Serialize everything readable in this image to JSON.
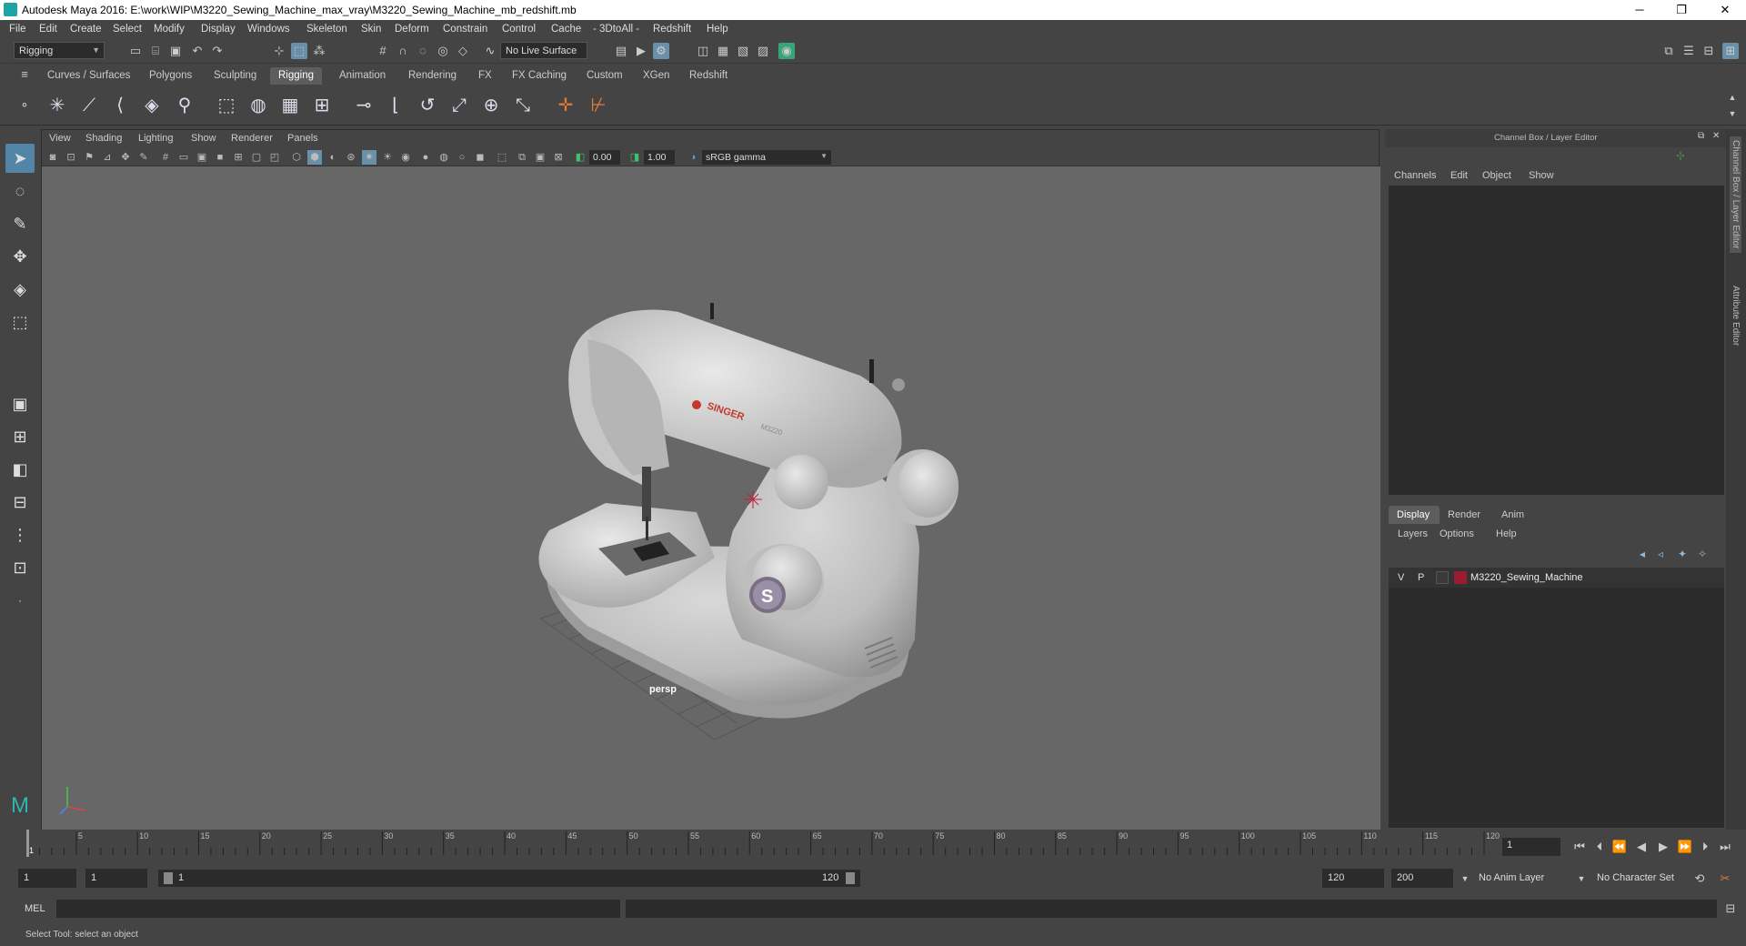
{
  "window": {
    "title": "Autodesk Maya 2016: E:\\work\\WIP\\M3220_Sewing_Machine_max_vray\\M3220_Sewing_Machine_mb_redshift.mb",
    "minimize": "─",
    "restore": "❐",
    "close": "✕"
  },
  "menubar": [
    "File",
    "Edit",
    "Create",
    "Select",
    "Modify",
    "Display",
    "Windows",
    "Skeleton",
    "Skin",
    "Deform",
    "Constrain",
    "Control",
    "Cache",
    "- 3DtoAll -",
    "Redshift",
    "Help"
  ],
  "statusline": {
    "menuset": "Rigging",
    "live_surface": "No Live Surface"
  },
  "shelf_tabs": [
    "Curves / Surfaces",
    "Polygons",
    "Sculpting",
    "Rigging",
    "Animation",
    "Rendering",
    "FX",
    "FX Caching",
    "Custom",
    "XGen",
    "Redshift"
  ],
  "active_shelf_tab": "Rigging",
  "viewport": {
    "menu": [
      "View",
      "Shading",
      "Lighting",
      "Show",
      "Renderer",
      "Panels"
    ],
    "exposure": "0.00",
    "gamma": "1.00",
    "color_space": "sRGB gamma",
    "camera": "persp"
  },
  "model": {
    "brand": "SINGER",
    "model_text": "M3220",
    "logo_letter": "S"
  },
  "channel_box": {
    "title": "Channel Box / Layer Editor",
    "menu": [
      "Channels",
      "Edit",
      "Object",
      "Show"
    ]
  },
  "layer_editor": {
    "tabs": [
      "Display",
      "Render",
      "Anim"
    ],
    "active_tab": "Display",
    "menu": [
      "Layers",
      "Options",
      "Help"
    ],
    "layers": [
      {
        "v": "V",
        "p": "P",
        "name": "M3220_Sewing_Machine",
        "color": "#9b1b30"
      }
    ]
  },
  "side_tabs": [
    "Channel Box / Layer Editor",
    "Attribute Editor"
  ],
  "timeline": {
    "ticks": [
      "1",
      "5",
      "10",
      "15",
      "20",
      "25",
      "30",
      "35",
      "40",
      "45",
      "50",
      "55",
      "60",
      "65",
      "70",
      "75",
      "80",
      "85",
      "90",
      "95",
      "100",
      "105",
      "110",
      "115",
      "120"
    ],
    "current_frame": "1"
  },
  "range": {
    "start": "1",
    "playback_start": "1",
    "slider_start": "1",
    "slider_end": "120",
    "playback_end": "120",
    "end": "200",
    "anim_layer": "No Anim Layer",
    "character_set": "No Character Set"
  },
  "mel": {
    "label": "MEL"
  },
  "help_line": "Select Tool: select an object",
  "colors": {
    "accent": "#5285a6",
    "viewport_bg": "#676767",
    "layer_color": "#9b1b30"
  }
}
